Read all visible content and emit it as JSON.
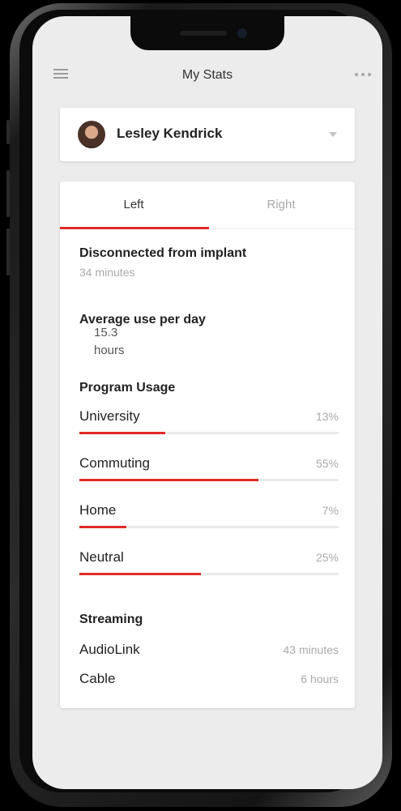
{
  "header": {
    "title": "My Stats"
  },
  "user": {
    "name": "Lesley Kendrick"
  },
  "tabs": [
    {
      "label": "Left"
    },
    {
      "label": "Right"
    }
  ],
  "disconnected": {
    "label": "Disconnected from implant",
    "value": "34 minutes"
  },
  "average": {
    "label": "Average use per day",
    "value": "15.3 hours"
  },
  "program_usage": {
    "title": "Program Usage",
    "items": [
      {
        "name": "University",
        "percent_label": "13%",
        "fill_percent": 33
      },
      {
        "name": "Commuting",
        "percent_label": "55%",
        "fill_percent": 69
      },
      {
        "name": "Home",
        "percent_label": "7%",
        "fill_percent": 18
      },
      {
        "name": "Neutral",
        "percent_label": "25%",
        "fill_percent": 47
      }
    ]
  },
  "streaming": {
    "title": "Streaming",
    "items": [
      {
        "name": "AudioLink",
        "value": "43 minutes"
      },
      {
        "name": "Cable",
        "value": "6 hours"
      }
    ]
  },
  "colors": {
    "accent": "#e12a2a",
    "background": "#ececec",
    "card": "#ffffff"
  }
}
